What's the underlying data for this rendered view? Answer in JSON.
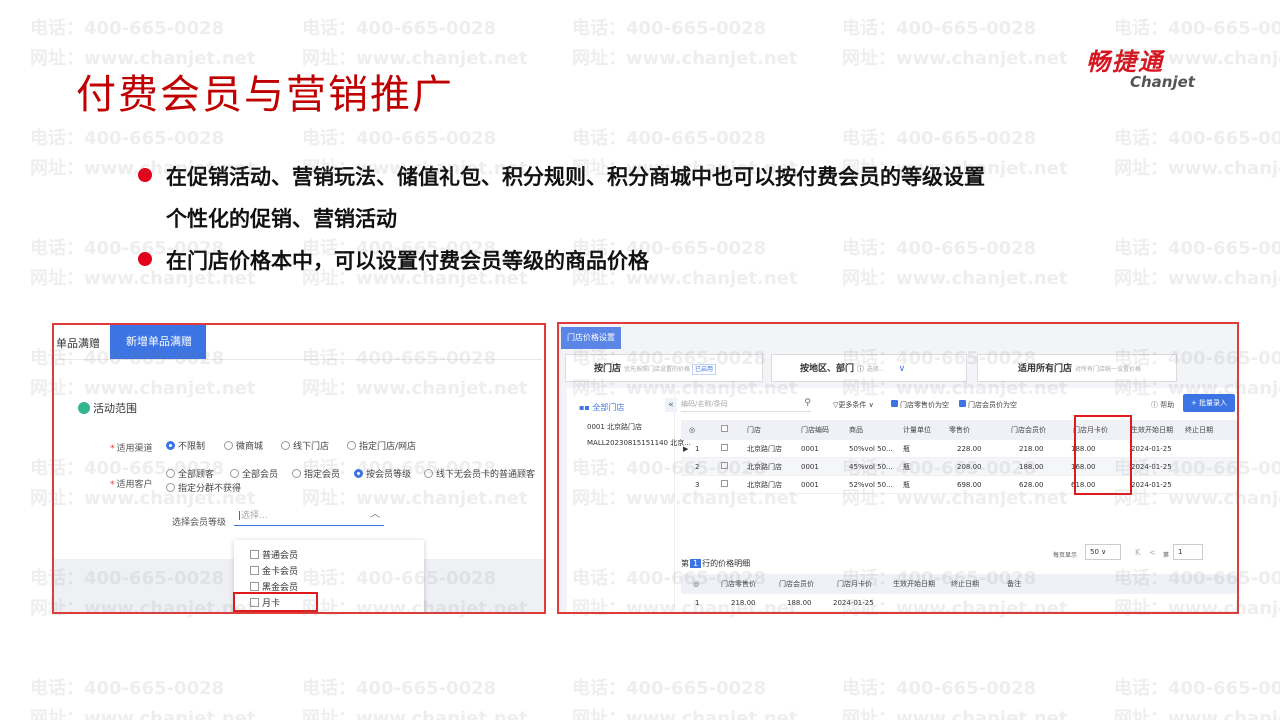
{
  "watermark": {
    "phone": "电话：400-665-0028",
    "site": "网址：www.chanjet.net"
  },
  "slide": {
    "title": "付费会员与营销推广",
    "logo_cn": "畅捷通",
    "logo_en": "Chanjet",
    "bullets": [
      "在促销活动、营销玩法、储值礼包、积分规则、积分商城中也可以按付费会员的等级设置",
      "个性化的促销、营销活动",
      "在门店价格本中，可以设置付费会员等级的商品价格"
    ]
  },
  "colors": {
    "accent": "#3c74e4",
    "title_red": "#c00000",
    "highlight": "#e01a1a"
  },
  "left_panel": {
    "tabs": [
      "单品满赠",
      "新增单品满赠"
    ],
    "tab_close": "×",
    "section_title": "活动范围",
    "channel_label": "适用渠道",
    "channel_options": [
      "不限制",
      "微商城",
      "线下门店",
      "指定门店/网店"
    ],
    "channel_selected": "不限制",
    "customer_label": "适用客户",
    "customer_options": [
      "全部顾客",
      "全部会员",
      "指定会员",
      "按会员等级",
      "线下无会员卡的普通顾客"
    ],
    "customer_option_extra": "指定分群不获得",
    "customer_selected": "按会员等级",
    "level_label": "选择会员等级",
    "level_placeholder": "选择...",
    "level_options": [
      "普通会员",
      "金卡会员",
      "黑金会员",
      "月卡"
    ],
    "level_highlighted": "月卡"
  },
  "right_panel": {
    "tab": "门店价格设置",
    "cards": [
      {
        "title": "按门店",
        "desc": "优先按照门店设置的价格",
        "tag": "已启用"
      },
      {
        "title": "按地区、部门",
        "icon": "help-icon",
        "desc": "选择..."
      },
      {
        "title": "适用所有门店",
        "desc": "对所有门店统一设置价格"
      }
    ],
    "tree_head": "全部门店",
    "tree_items": [
      "0001 北京路门店",
      "MALL20230815151140 北京..."
    ],
    "search_placeholder": "编码/名称/条码",
    "more_filter": "更多条件",
    "check1": "门店零售价为空",
    "check2": "门店会员价为空",
    "help": "帮助",
    "add_button": "+ 批量录入",
    "columns": [
      "◎",
      "",
      "门店",
      "门店编码",
      "商品",
      "计量单位",
      "零售价",
      "门店会员价",
      "门店月卡价",
      "生效开始日期",
      "终止日期"
    ],
    "rows": [
      [
        "1",
        "北京路门店",
        "0001",
        "50%vol 50...",
        "瓶",
        "228.00",
        "218.00",
        "188.00",
        "2024-01-25",
        ""
      ],
      [
        "2",
        "北京路门店",
        "0001",
        "45%vol 50...",
        "瓶",
        "208.00",
        "188.00",
        "168.00",
        "2024-01-25",
        ""
      ],
      [
        "3",
        "北京路门店",
        "0001",
        "52%vol 50...",
        "瓶",
        "698.00",
        "628.00",
        "618.00",
        "2024-01-25",
        ""
      ]
    ],
    "pager": {
      "per_page_label": "每页显示",
      "per_page": "50",
      "first": "K",
      "prev": "<",
      "page_prefix": "第",
      "page": "1"
    },
    "detail_title_pre": "第",
    "detail_row_num": "1",
    "detail_title_post": "行的价格明细",
    "detail_columns": [
      "◎",
      "门店零售价",
      "门店会员价",
      "门店月卡价",
      "生效开始日期",
      "终止日期",
      "备注"
    ],
    "detail_rows": [
      [
        "1",
        "218.00",
        "188.00",
        "2024-01-25",
        "",
        ""
      ]
    ]
  }
}
